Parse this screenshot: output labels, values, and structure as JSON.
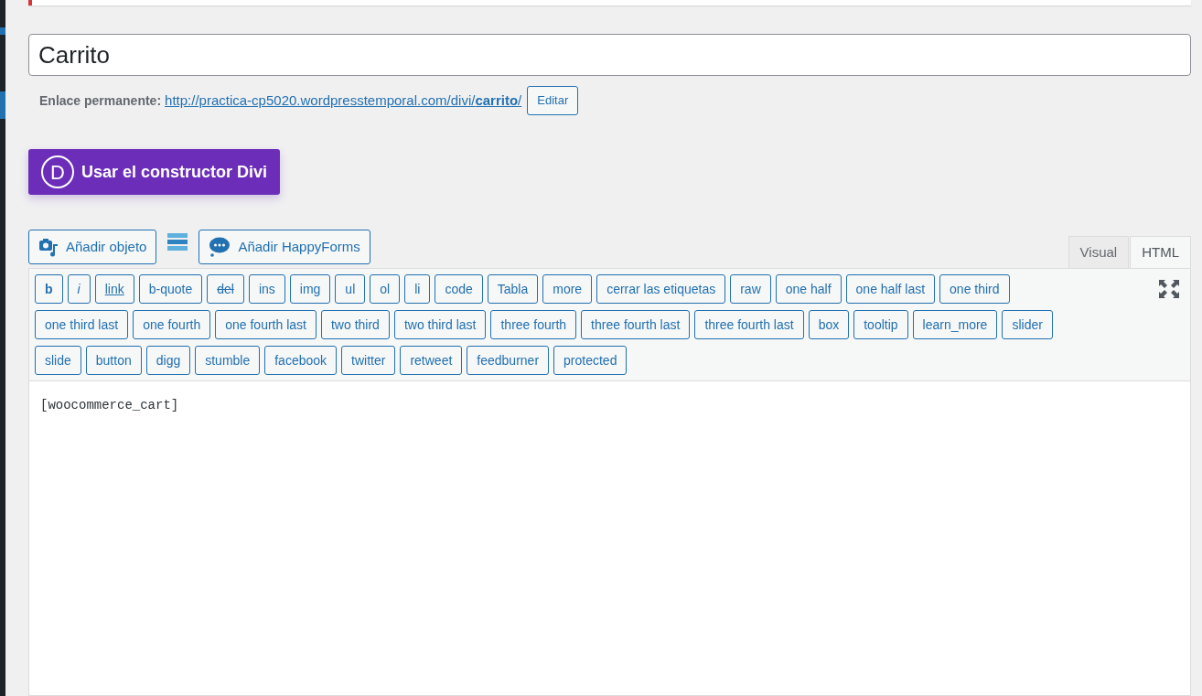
{
  "title_field": {
    "value": "Carrito"
  },
  "permalink": {
    "label": "Enlace permanente:",
    "url_prefix": "http://practica-cp5020.wordpresstemporal.com/divi/",
    "url_slug": "carrito",
    "url_suffix": "/",
    "edit_button": "Editar"
  },
  "divi_button": {
    "logo": "D",
    "label": "Usar el constructor Divi"
  },
  "media_buttons": [
    {
      "kind": "media",
      "label": "Añadir objeto"
    },
    {
      "kind": "menu"
    },
    {
      "kind": "forms",
      "label": "Añadir HappyForms"
    }
  ],
  "editor_tabs": [
    {
      "label": "Visual",
      "selected": false
    },
    {
      "label": "HTML",
      "selected": true
    }
  ],
  "quicktags": [
    {
      "label": "b",
      "kind": "bold"
    },
    {
      "label": "i",
      "kind": "italic"
    },
    {
      "label": "link",
      "kind": "link"
    },
    {
      "label": "b-quote",
      "kind": "plain"
    },
    {
      "label": "del",
      "kind": "strike"
    },
    {
      "label": "ins",
      "kind": "plain"
    },
    {
      "label": "img",
      "kind": "plain"
    },
    {
      "label": "ul",
      "kind": "plain"
    },
    {
      "label": "ol",
      "kind": "plain"
    },
    {
      "label": "li",
      "kind": "plain"
    },
    {
      "label": "code",
      "kind": "plain"
    },
    {
      "label": "Tabla",
      "kind": "plain"
    },
    {
      "label": "more",
      "kind": "plain"
    },
    {
      "label": "cerrar las etiquetas",
      "kind": "plain"
    },
    {
      "label": "raw",
      "kind": "plain"
    },
    {
      "label": "one half",
      "kind": "plain"
    },
    {
      "label": "one half last",
      "kind": "plain"
    },
    {
      "label": "one third",
      "kind": "plain"
    },
    {
      "label": "one third last",
      "kind": "plain"
    },
    {
      "label": "one fourth",
      "kind": "plain"
    },
    {
      "label": "one fourth last",
      "kind": "plain"
    },
    {
      "label": "two third",
      "kind": "plain"
    },
    {
      "label": "two third last",
      "kind": "plain"
    },
    {
      "label": "three fourth",
      "kind": "plain"
    },
    {
      "label": "three fourth last",
      "kind": "plain"
    },
    {
      "label": "three fourth last",
      "kind": "plain"
    },
    {
      "label": "box",
      "kind": "plain"
    },
    {
      "label": "tooltip",
      "kind": "plain"
    },
    {
      "label": "learn_more",
      "kind": "plain"
    },
    {
      "label": "slider",
      "kind": "plain"
    },
    {
      "label": "slide",
      "kind": "plain"
    },
    {
      "label": "button",
      "kind": "plain"
    },
    {
      "label": "digg",
      "kind": "plain"
    },
    {
      "label": "stumble",
      "kind": "plain"
    },
    {
      "label": "facebook",
      "kind": "plain"
    },
    {
      "label": "twitter",
      "kind": "plain"
    },
    {
      "label": "retweet",
      "kind": "plain"
    },
    {
      "label": "feedburner",
      "kind": "plain"
    },
    {
      "label": "protected",
      "kind": "plain"
    }
  ],
  "editor_content": "[woocommerce_cart]"
}
